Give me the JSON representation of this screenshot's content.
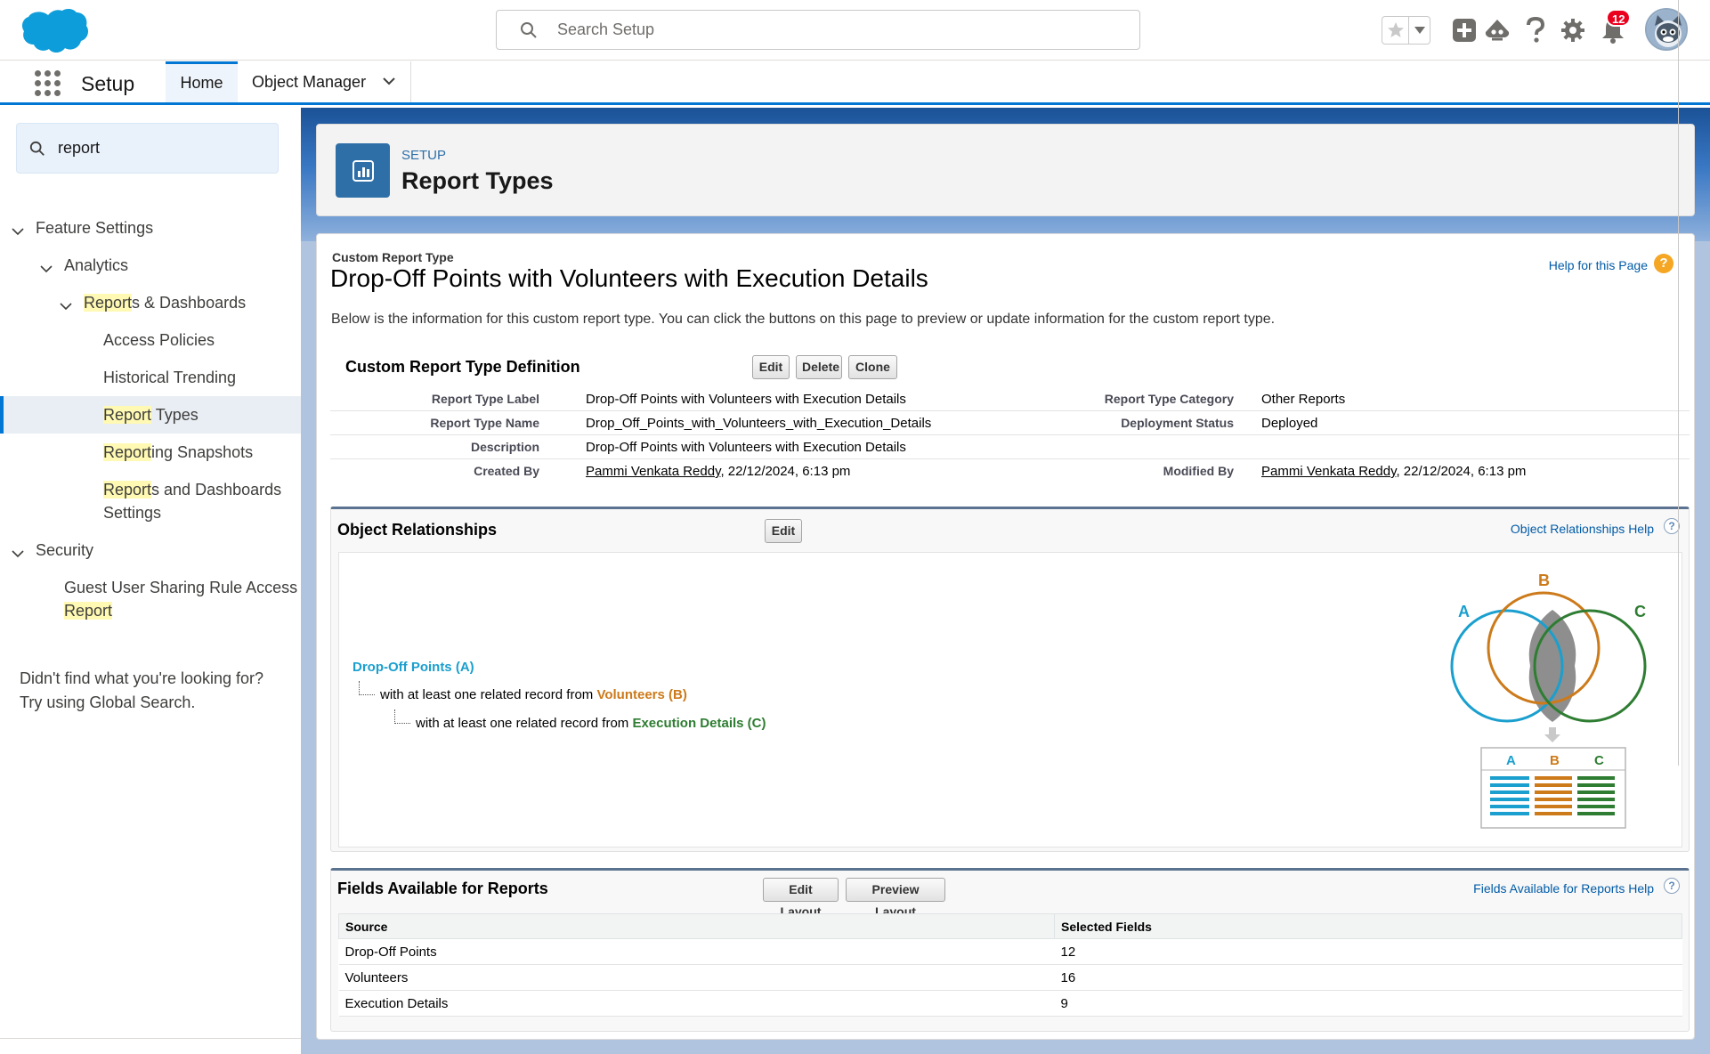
{
  "header": {
    "search_placeholder": "Search Setup",
    "notification_count": "12"
  },
  "context_bar": {
    "app_name": "Setup",
    "tabs": [
      {
        "label": "Home"
      },
      {
        "label": "Object Manager"
      }
    ]
  },
  "sidebar": {
    "search_value": "report",
    "tree": {
      "feature_settings": "Feature Settings",
      "analytics": "Analytics",
      "reports_dashboards_hl": "Report",
      "reports_dashboards_rest": "s & Dashboards",
      "access_policies": "Access Policies",
      "historical_trending": "Historical Trending",
      "report_types_hl": "Report",
      "report_types_rest": " Types",
      "reporting_snapshots_hl": "Report",
      "reporting_snapshots_rest": "ing Snapshots",
      "rd_settings_hl": "Report",
      "rd_settings_rest1": "s and Dashboards",
      "rd_settings_rest2": "Settings",
      "security": "Security",
      "guest_line1": "Guest User Sharing Rule Access",
      "guest_line2_hl": "Report"
    },
    "help_text_1": "Didn't find what you're looking for?",
    "help_text_2": "Try using Global Search."
  },
  "page_header": {
    "eyebrow": "SETUP",
    "title": "Report Types"
  },
  "content": {
    "eyebrow": "Custom Report Type",
    "title": "Drop-Off Points with Volunteers with Execution Details",
    "help_link": "Help for this Page",
    "intro": "Below is the information for this custom report type. You can click the buttons on this page to preview or update information for the custom report type.",
    "definition": {
      "title": "Custom Report Type Definition",
      "buttons": {
        "edit": "Edit",
        "delete": "Delete",
        "clone": "Clone"
      },
      "rows": [
        {
          "label": "Report Type Label",
          "value": "Drop-Off Points with Volunteers with Execution Details",
          "label2": "Report Type Category",
          "value2": "Other Reports"
        },
        {
          "label": "Report Type Name",
          "value": "Drop_Off_Points_with_Volunteers_with_Execution_Details",
          "label2": "Deployment Status",
          "value2": "Deployed"
        },
        {
          "label": "Description",
          "value": "Drop-Off Points with Volunteers with Execution Details"
        },
        {
          "label": "Created By",
          "user": "Pammi Venkata Reddy",
          "date": ", 22/12/2024, 6:13 pm",
          "label2": "Modified By",
          "user2": "Pammi Venkata Reddy",
          "date2": ", 22/12/2024, 6:13 pm"
        }
      ]
    },
    "relationships": {
      "title": "Object Relationships",
      "edit": "Edit",
      "help": "Object Relationships Help",
      "object_a": "Drop-Off Points (A)",
      "line_b_prefix": "with at least one related record from ",
      "object_b": "Volunteers (B)",
      "line_c_prefix": "with at least one related record from ",
      "object_c": "Execution Details (C)",
      "diagram_labels": {
        "a": "A",
        "b": "B",
        "c": "C"
      },
      "colors": {
        "a": "#1a9fce",
        "b": "#cc7a1a",
        "c": "#2e7d32"
      }
    },
    "fields": {
      "title": "Fields Available for Reports",
      "edit_layout": "Edit Layout",
      "preview_layout": "Preview Layout",
      "help": "Fields Available for Reports Help",
      "columns": [
        "Source",
        "Selected Fields"
      ],
      "rows": [
        {
          "source": "Drop-Off Points",
          "count": "12"
        },
        {
          "source": "Volunteers",
          "count": "16"
        },
        {
          "source": "Execution Details",
          "count": "9"
        }
      ]
    }
  }
}
